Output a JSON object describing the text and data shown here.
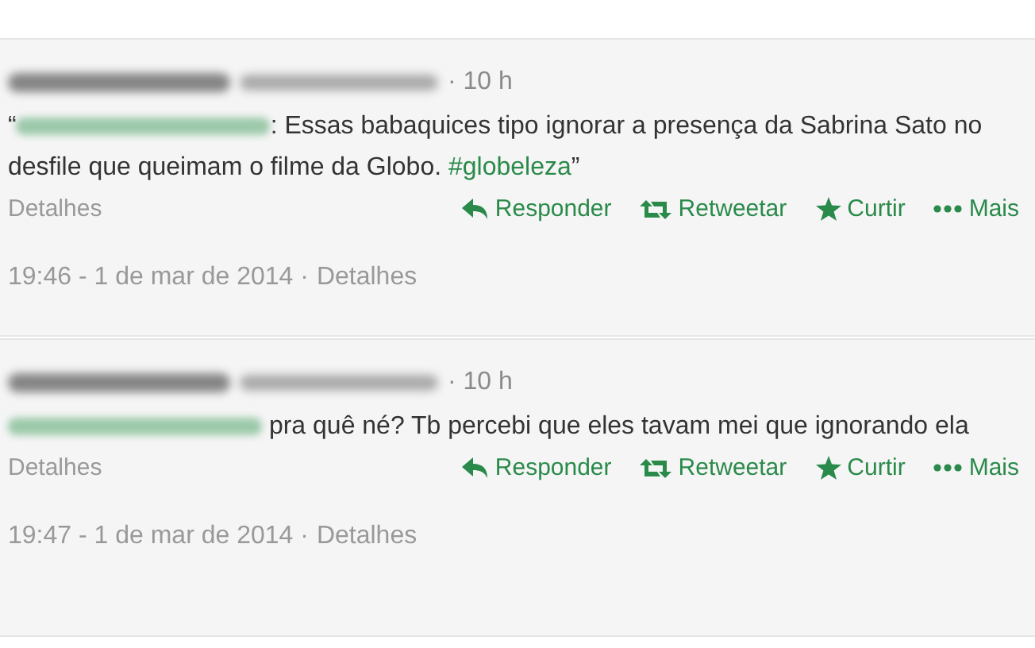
{
  "tweets": [
    {
      "time_ago": "· 10 h",
      "body": [
        {
          "kind": "quote",
          "text": "“"
        },
        {
          "kind": "mention"
        },
        {
          "kind": "plain",
          "text": ": Essas babaquices tipo ignorar a presença da Sabrina Sato no desfile que queimam o filme da Globo. "
        },
        {
          "kind": "hashtag",
          "text": "#globeleza"
        },
        {
          "kind": "quote",
          "text": "”"
        }
      ],
      "details": "Detalhes",
      "actions": [
        {
          "kind": "reply",
          "label": "Responder"
        },
        {
          "kind": "retweet",
          "label": "Retweetar"
        },
        {
          "kind": "favorite",
          "label": "Curtir"
        },
        {
          "kind": "more",
          "label": "Mais"
        }
      ],
      "timestamp": "19:46 - 1 de mar de 2014 ·",
      "timestamp_link": "Detalhes"
    },
    {
      "time_ago": "· 10 h",
      "body": [
        {
          "kind": "mention"
        },
        {
          "kind": "plain",
          "text": " pra quê né? Tb percebi que eles tavam mei que ignorando ela"
        }
      ],
      "details": "Detalhes",
      "actions": [
        {
          "kind": "reply",
          "label": "Responder"
        },
        {
          "kind": "retweet",
          "label": "Retweetar"
        },
        {
          "kind": "favorite",
          "label": "Curtir"
        },
        {
          "kind": "more",
          "label": "Mais"
        }
      ],
      "timestamp": "19:47 - 1 de mar de 2014 ·",
      "timestamp_link": "Detalhes"
    }
  ]
}
